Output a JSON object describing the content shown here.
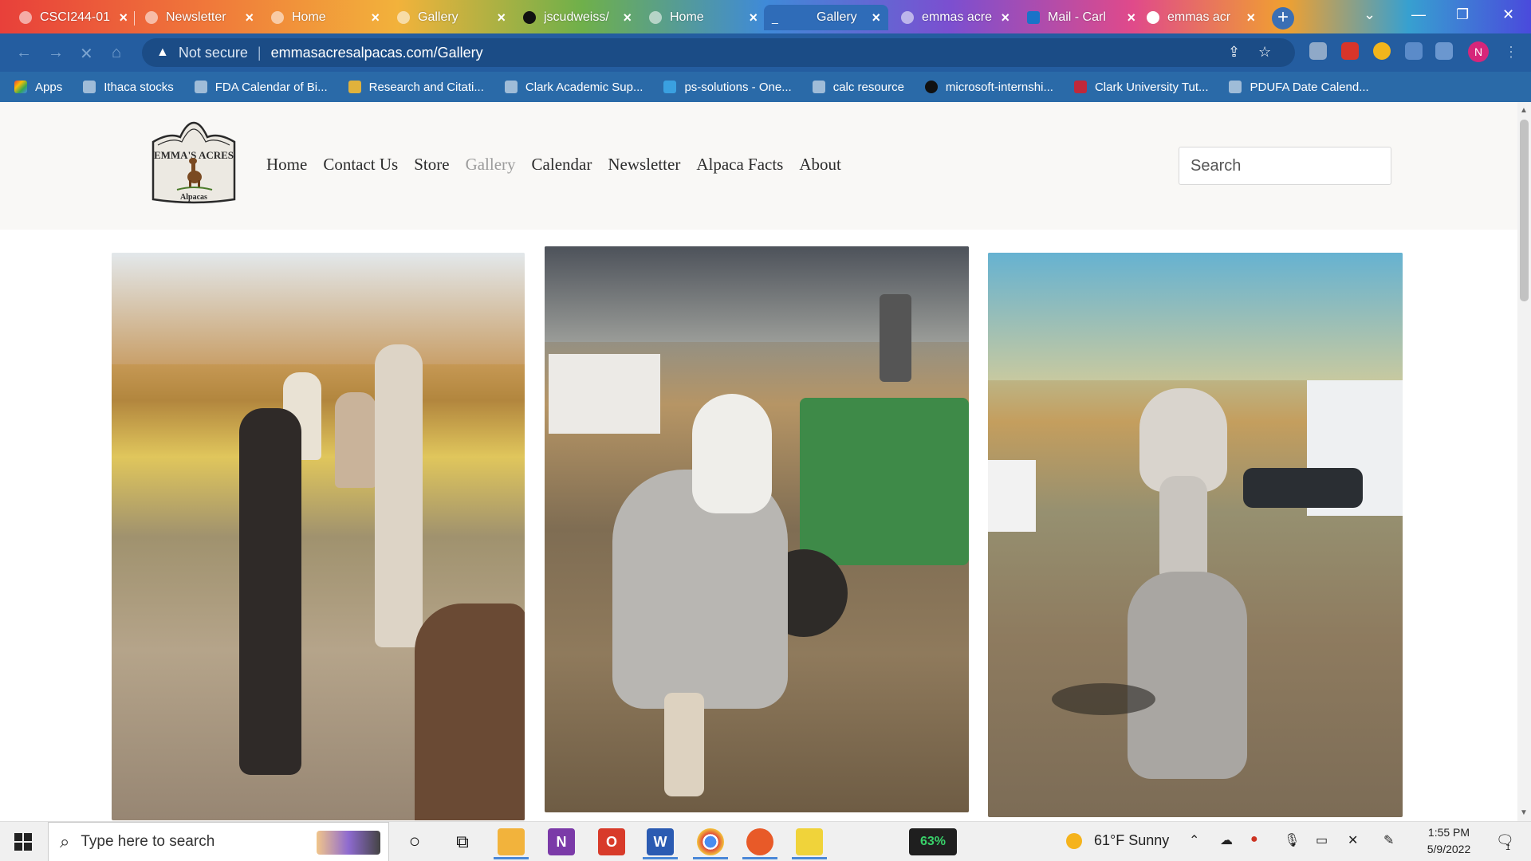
{
  "browser": {
    "tabs": [
      {
        "title": "CSCI244-01",
        "active": false
      },
      {
        "title": "Newsletter",
        "active": false
      },
      {
        "title": "Home",
        "active": false
      },
      {
        "title": "Gallery",
        "active": false
      },
      {
        "title": "jscudweiss/",
        "active": false
      },
      {
        "title": "Home",
        "active": false
      },
      {
        "title": "Gallery",
        "active": true
      },
      {
        "title": "emmas acre",
        "active": false
      },
      {
        "title": "Mail - Carl",
        "active": false
      },
      {
        "title": "emmas acr",
        "active": false
      }
    ],
    "security_label": "Not secure",
    "url": "emmasacresalpacas.com/Gallery",
    "profile_initial": "N",
    "bookmarks": [
      "Apps",
      "Ithaca stocks",
      "FDA Calendar of Bi...",
      "Research and Citati...",
      "Clark Academic Sup...",
      "ps-solutions - One...",
      "calc resource",
      "microsoft-internshi...",
      "Clark University Tut...",
      "PDUFA Date Calend..."
    ]
  },
  "site": {
    "logo_text": {
      "line1": "EMMA'S ACRES",
      "line2": "Alpacas"
    },
    "nav": [
      "Home",
      "Contact Us",
      "Store",
      "Gallery",
      "Calendar",
      "Newsletter",
      "Alpaca Facts",
      "About"
    ],
    "current_nav": "Gallery",
    "search_placeholder": "Search"
  },
  "taskbar": {
    "search_placeholder": "Type here to search",
    "battery": "63%",
    "weather": "61°F  Sunny",
    "time": "1:55 PM",
    "date": "5/9/2022",
    "notifications": "1"
  },
  "colors": {
    "tab_active": "#2f6cb8",
    "omnibar": "#245da0",
    "nav_current": "#9c9c9c",
    "header_bg": "#f9f8f6"
  }
}
